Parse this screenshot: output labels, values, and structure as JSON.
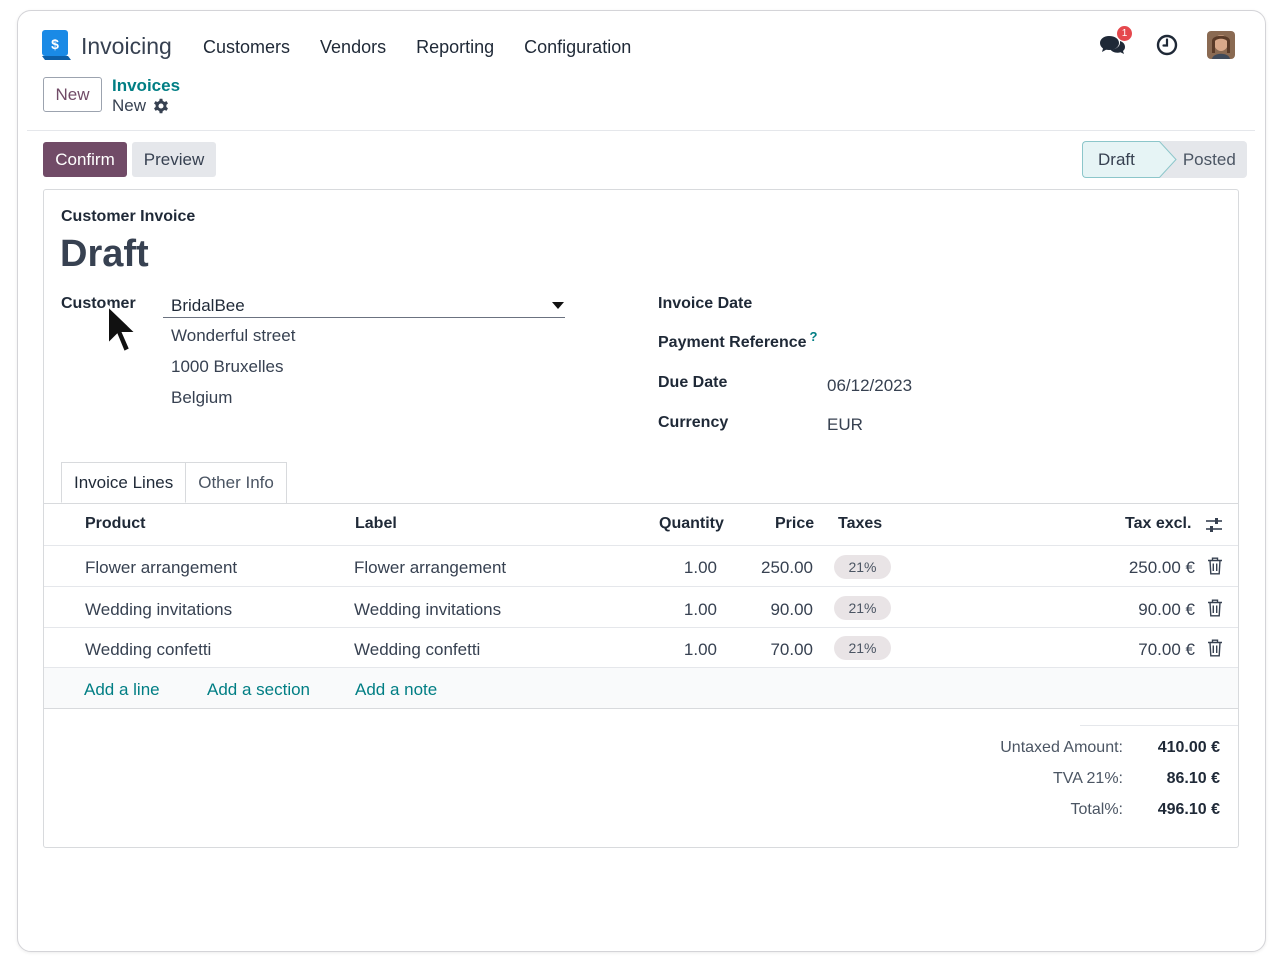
{
  "app": {
    "title": "Invoicing",
    "accent_color": "#714b67",
    "link_color": "#017e84"
  },
  "nav": {
    "items": [
      "Customers",
      "Vendors",
      "Reporting",
      "Configuration"
    ]
  },
  "topbar": {
    "chat_icon": "chat-bubbles-icon",
    "chat_badge": "1",
    "activity_icon": "clock-icon",
    "avatar": "user-avatar"
  },
  "breadcrumb": {
    "new_label": "New",
    "parent": "Invoices",
    "current": "New"
  },
  "actions": {
    "confirm": "Confirm",
    "preview": "Preview"
  },
  "status": {
    "steps": [
      "Draft",
      "Posted"
    ],
    "active": "Draft"
  },
  "form": {
    "doc_type": "Customer Invoice",
    "doc_name": "Draft",
    "customer_label": "Customer",
    "customer_value": "BridalBee",
    "address": [
      "Wonderful street",
      "1000 Bruxelles",
      "Belgium"
    ],
    "invoice_date_label": "Invoice Date",
    "invoice_date_value": "",
    "payment_ref_label": "Payment Reference",
    "payment_ref_help": "?",
    "due_date_label": "Due Date",
    "due_date_value": "06/12/2023",
    "currency_label": "Currency",
    "currency_value": "EUR"
  },
  "tabs": [
    "Invoice Lines",
    "Other Info"
  ],
  "lines": {
    "headers": {
      "product": "Product",
      "label": "Label",
      "quantity": "Quantity",
      "price": "Price",
      "taxes": "Taxes",
      "subtotal": "Tax excl."
    },
    "rows": [
      {
        "product": "Flower arrangement",
        "label": "Flower arrangement",
        "quantity": "1.00",
        "price": "250.00",
        "tax": "21%",
        "subtotal": "250.00 €"
      },
      {
        "product": "Wedding invitations",
        "label": "Wedding invitations",
        "quantity": "1.00",
        "price": "90.00",
        "tax": "21%",
        "subtotal": "90.00 €"
      },
      {
        "product": "Wedding confetti",
        "label": "Wedding confetti",
        "quantity": "1.00",
        "price": "70.00",
        "tax": "21%",
        "subtotal": "70.00 €"
      }
    ],
    "add_line": "Add a line",
    "add_section": "Add a section",
    "add_note": "Add a note"
  },
  "totals": {
    "untaxed_label": "Untaxed Amount:",
    "untaxed_value": "410.00 €",
    "tax_label": "TVA 21%:",
    "tax_value": "86.10 €",
    "total_label": "Total%:",
    "total_value": "496.10 €"
  }
}
